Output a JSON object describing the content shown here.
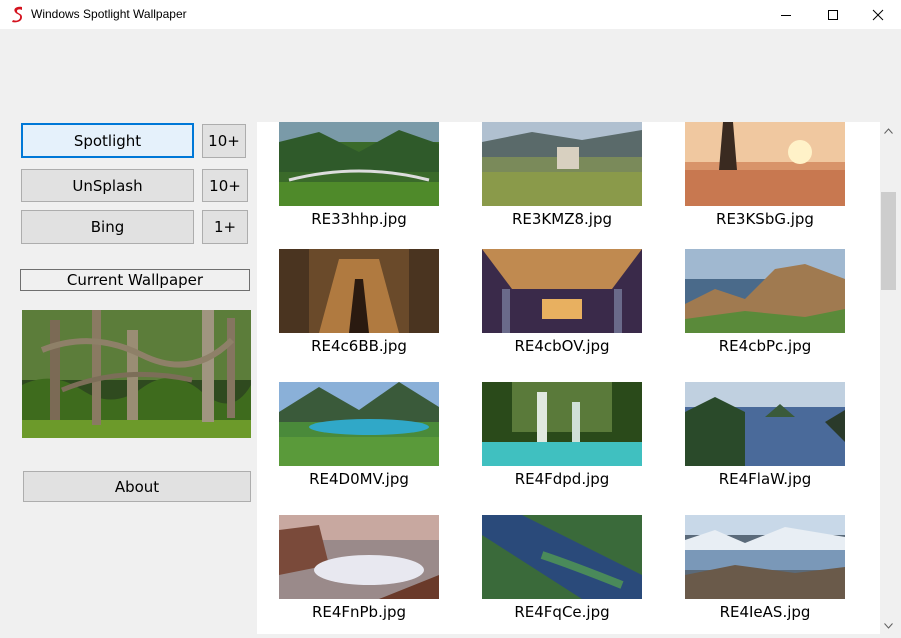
{
  "window": {
    "title": "Windows Spotlight Wallpaper",
    "controls": [
      "minimize",
      "maximize",
      "close"
    ]
  },
  "sources": [
    {
      "label": "Spotlight",
      "count": "10+",
      "active": true
    },
    {
      "label": "UnSplash",
      "count": "10+",
      "active": false
    },
    {
      "label": "Bing",
      "count": "1+",
      "active": false
    }
  ],
  "current_wallpaper": {
    "label": "Current Wallpaper",
    "image": "forest with twisted trees"
  },
  "about_label": "About",
  "gallery": {
    "items": [
      {
        "filename": "RE33hhp.jpg",
        "image": "green valley with arched bridge"
      },
      {
        "filename": "RE3KMZ8.jpg",
        "image": "ancient ruins in mountain valley"
      },
      {
        "filename": "RE3KSbG.jpg",
        "image": "temple on lake at sunset"
      },
      {
        "filename": "RE4c6BB.jpg",
        "image": "stone arched tunnel"
      },
      {
        "filename": "RE4cbOV.jpg",
        "image": "ornate hall with columns"
      },
      {
        "filename": "RE4cbPc.jpg",
        "image": "castle ruins on sea cliff"
      },
      {
        "filename": "RE4D0MV.jpg",
        "image": "alpine lake and town"
      },
      {
        "filename": "RE4Fdpd.jpg",
        "image": "jungle waterfall with turquoise pools"
      },
      {
        "filename": "RE4FlaW.jpg",
        "image": "rocky coastline islands"
      },
      {
        "filename": "RE4FnPb.jpg",
        "image": "waves crashing on cliffs"
      },
      {
        "filename": "RE4FqCe.jpg",
        "image": "aerial river delta"
      },
      {
        "filename": "RE4IeAS.jpg",
        "image": "arctic icebergs and mountains"
      }
    ]
  },
  "colors": {
    "accent": "#0078d7",
    "brand_icon": "#e81123"
  }
}
